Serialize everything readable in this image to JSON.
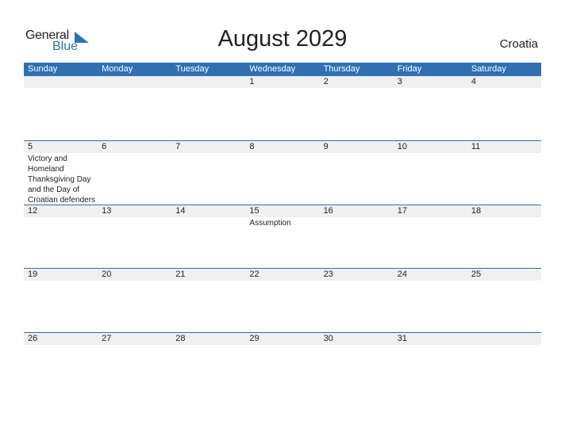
{
  "logo": {
    "general": "General",
    "blue": "Blue"
  },
  "title": "August 2029",
  "country": "Croatia",
  "weekdays": [
    "Sunday",
    "Monday",
    "Tuesday",
    "Wednesday",
    "Thursday",
    "Friday",
    "Saturday"
  ],
  "weeks": [
    {
      "days": [
        "",
        "",
        "",
        "1",
        "2",
        "3",
        "4"
      ],
      "events": [
        "",
        "",
        "",
        "",
        "",
        "",
        ""
      ]
    },
    {
      "days": [
        "5",
        "6",
        "7",
        "8",
        "9",
        "10",
        "11"
      ],
      "events": [
        "Victory and Homeland Thanksgiving Day and the Day of Croatian defenders",
        "",
        "",
        "",
        "",
        "",
        ""
      ]
    },
    {
      "days": [
        "12",
        "13",
        "14",
        "15",
        "16",
        "17",
        "18"
      ],
      "events": [
        "",
        "",
        "",
        "Assumption",
        "",
        "",
        ""
      ]
    },
    {
      "days": [
        "19",
        "20",
        "21",
        "22",
        "23",
        "24",
        "25"
      ],
      "events": [
        "",
        "",
        "",
        "",
        "",
        "",
        ""
      ]
    },
    {
      "days": [
        "26",
        "27",
        "28",
        "29",
        "30",
        "31",
        ""
      ],
      "events": [
        "",
        "",
        "",
        "",
        "",
        "",
        ""
      ]
    }
  ]
}
